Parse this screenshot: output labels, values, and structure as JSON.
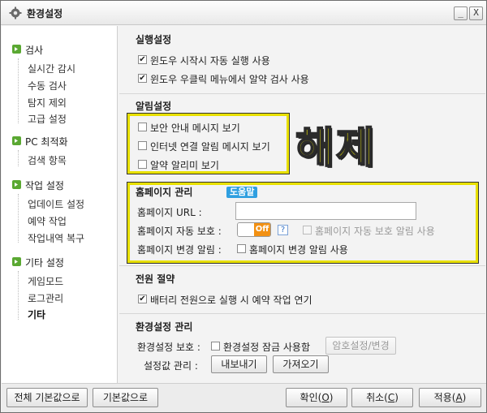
{
  "window": {
    "title": "환경설정",
    "minimize_label": "_",
    "close_label": "X"
  },
  "sidebar": {
    "categories": [
      {
        "label": "검사",
        "items": [
          "실시간 감시",
          "수동 검사",
          "탐지 제외",
          "고급 설정"
        ]
      },
      {
        "label": "PC 최적화",
        "items": [
          "검색 항목"
        ]
      },
      {
        "label": "작업 설정",
        "items": [
          "업데이트 설정",
          "예약 작업",
          "작업내역 복구"
        ]
      },
      {
        "label": "기타 설정",
        "items": [
          "게임모드",
          "로그관리",
          "기타"
        ]
      }
    ],
    "active_item": "기타"
  },
  "sections": {
    "run": {
      "title": "실행설정",
      "options": [
        {
          "label": "윈도우 시작시 자동 실행 사용",
          "checked": true
        },
        {
          "label": "윈도우 우클릭 메뉴에서 알약 검사 사용",
          "checked": true
        }
      ]
    },
    "alert": {
      "title": "알림설정",
      "options": [
        {
          "label": "보안 안내 메시지 보기",
          "checked": false
        },
        {
          "label": "인터넷 연결 알림 메시지 보기",
          "checked": false
        },
        {
          "label": "알약 알리미 보기",
          "checked": false
        }
      ],
      "annotation": "해제"
    },
    "homepage": {
      "title": "홈페이지 관리",
      "help_badge": "도움말",
      "url_label": "홈페이지 URL :",
      "url_value": "",
      "protect_label": "홈페이지 자동 보호 :",
      "toggle_state": "Off",
      "help_icon_text": "?",
      "protect_alert_option": {
        "label": "홈페이지 자동 보호 알림 사용",
        "checked": false,
        "disabled": true
      },
      "change_label": "홈페이지 변경 알림 :",
      "change_alert_option": {
        "label": "홈페이지 변경 알림 사용",
        "checked": false
      }
    },
    "power": {
      "title": "전원 절약",
      "options": [
        {
          "label": "배터리 전원으로 실행 시 예약 작업 연기",
          "checked": true
        }
      ]
    },
    "env": {
      "title": "환경설정 관리",
      "protect_label": "환경설정 보호 :",
      "lock_option": {
        "label": "환경설정 잠금 사용함",
        "checked": false
      },
      "password_button": "암호설정/변경",
      "manage_label": "설정값 관리 :",
      "export_button": "내보내기",
      "import_button": "가져오기"
    }
  },
  "footer": {
    "reset_all": "전체 기본값으로",
    "reset": "기본값으로",
    "ok": {
      "text": "확인",
      "key": "O"
    },
    "cancel": {
      "text": "취소",
      "key": "C"
    },
    "apply": {
      "text": "적용",
      "key": "A"
    }
  },
  "colors": {
    "highlight": "#e8e000",
    "toggle_off": "#f29012",
    "help_badge": "#2f9fe0",
    "category_icon": "#5aa832"
  }
}
